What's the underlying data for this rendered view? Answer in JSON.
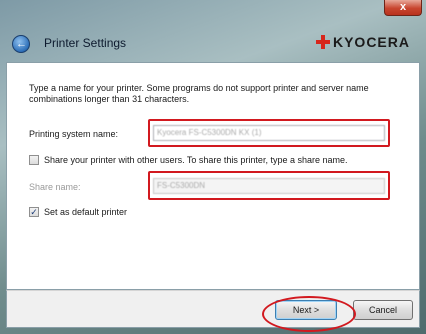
{
  "window": {
    "close_glyph": "x"
  },
  "header": {
    "title": "Printer Settings",
    "logo_text": "KYOCERA",
    "back_icon": "back-arrow-icon"
  },
  "content": {
    "instruction": "Type a name for your printer. Some programs do not support printer and server name combinations longer than 31 characters.",
    "printing_system_label": "Printing system name:",
    "printing_system_value": "Kyocera FS-C5300DN KX (1)",
    "share_checkbox_label": "Share your printer with other users. To share this printer, type a share name.",
    "share_checked": false,
    "share_name_label": "Share name:",
    "share_name_value": "FS-C5300DN",
    "default_checkbox_label": "Set as default printer",
    "default_checked": true
  },
  "footer": {
    "next_label": "Next >",
    "cancel_label": "Cancel"
  },
  "colors": {
    "highlight": "#d2191f",
    "logo_mark": "#d7261b"
  }
}
